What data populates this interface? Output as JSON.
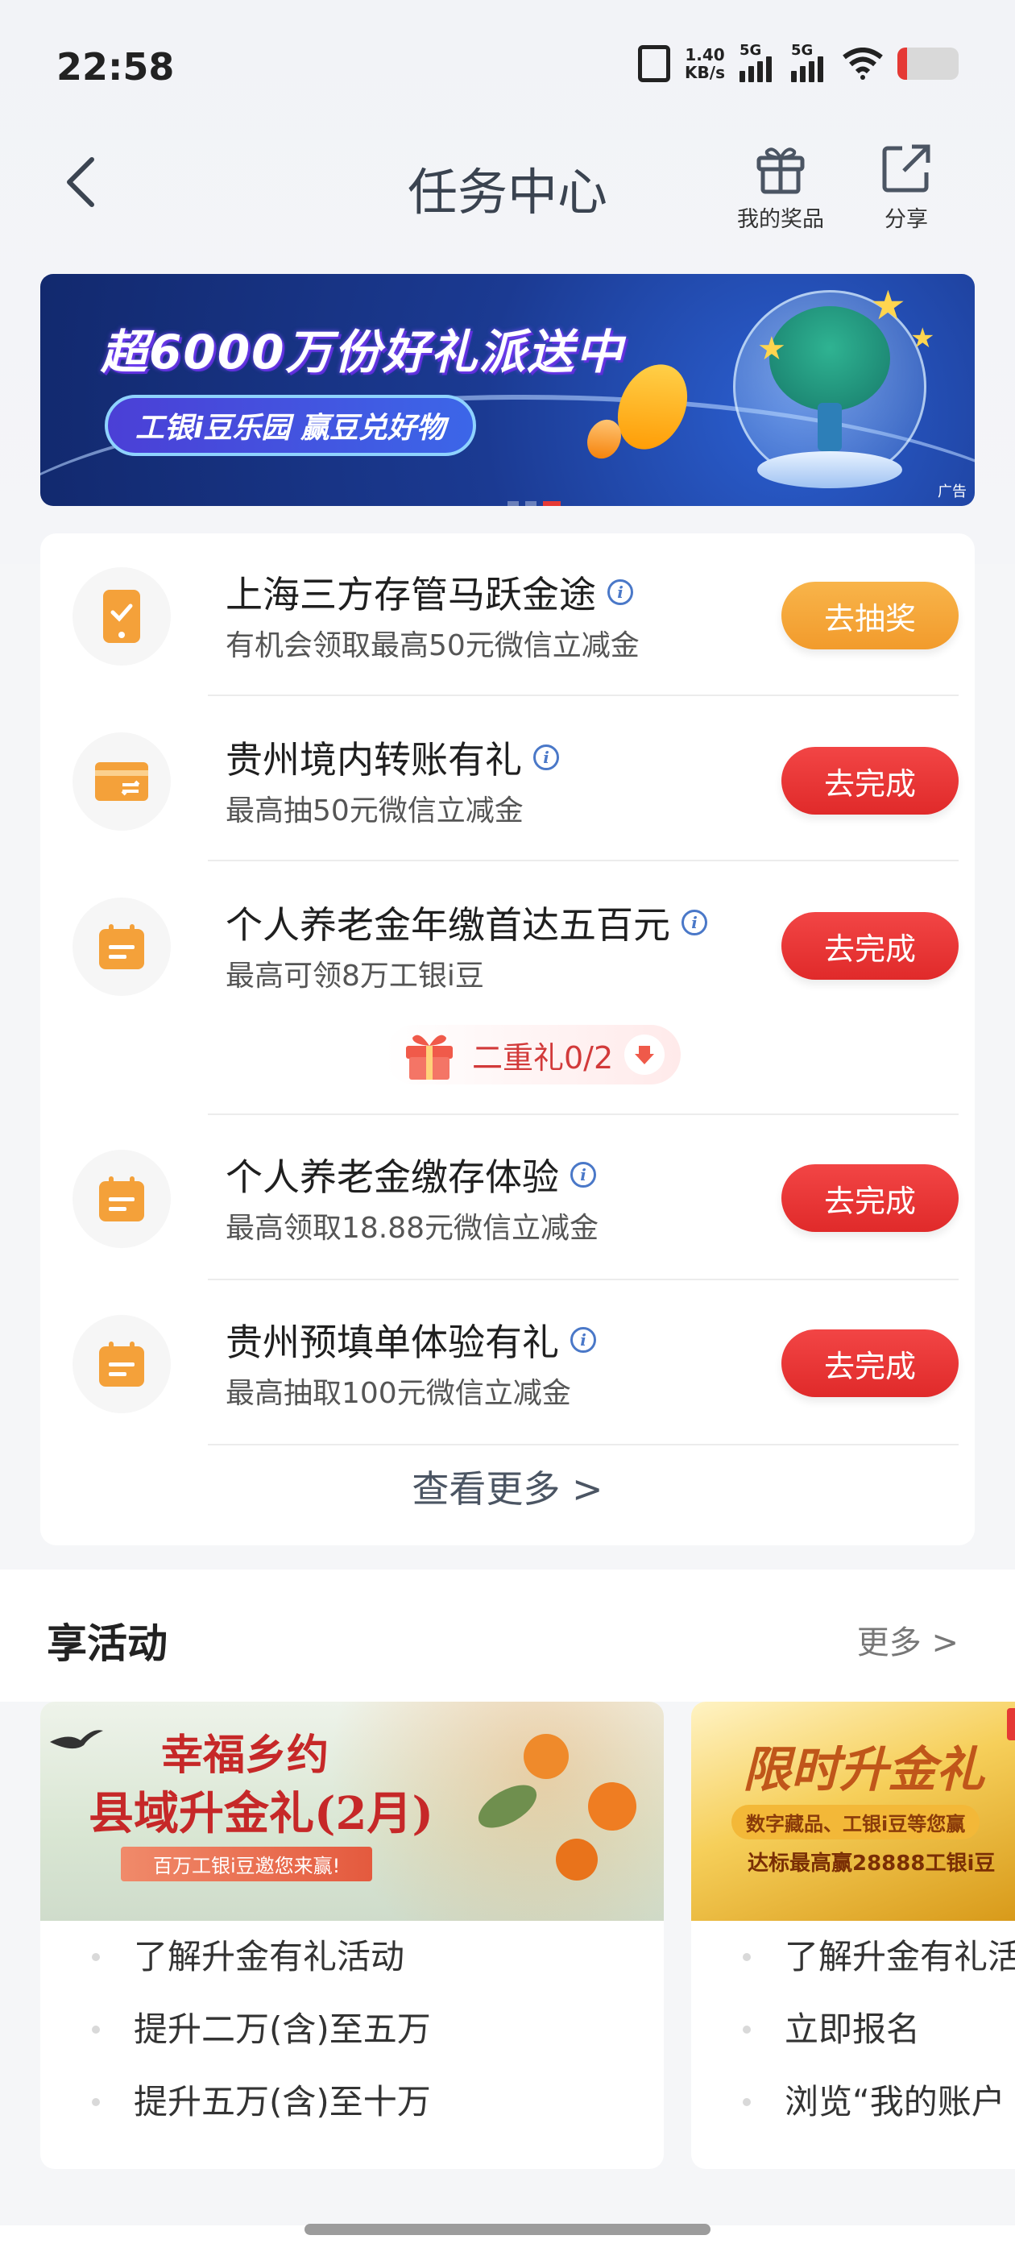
{
  "status_bar": {
    "time": "22:58",
    "net_speed_value": "1.40",
    "net_speed_unit": "KB/s",
    "signal1_label": "5G",
    "signal2_label": "5G"
  },
  "nav": {
    "title": "任务中心",
    "my_prizes_label": "我的奖品",
    "share_label": "分享"
  },
  "banner": {
    "headline": "超6000万份好礼派送中",
    "subline": "工银i豆乐园 赢豆兑好物",
    "ad_tag": "广告"
  },
  "tasks": [
    {
      "title": "上海三方存管马跃金途",
      "subtitle": "有机会领取最高50元微信立减金",
      "button": "去抽奖",
      "icon": "phone-icon"
    },
    {
      "title": "贵州境内转账有礼",
      "subtitle": "最高抽50元微信立减金",
      "button": "去完成",
      "icon": "card-transfer-icon"
    },
    {
      "title": "个人养老金年缴首达五百元",
      "subtitle": "最高可领8万工银i豆",
      "button": "去完成",
      "icon": "calendar-icon"
    },
    {
      "title": "个人养老金缴存体验",
      "subtitle": "最高领取18.88元微信立减金",
      "button": "去完成",
      "icon": "calendar-icon"
    },
    {
      "title": "贵州预填单体验有礼",
      "subtitle": "最高抽取100元微信立减金",
      "button": "去完成",
      "icon": "calendar-icon"
    }
  ],
  "gift_pill": {
    "label": "二重礼0/2"
  },
  "more_tasks": "查看更多 >",
  "activities": {
    "heading": "享活动",
    "more": "更多 >",
    "cards": [
      {
        "image_title_1": "幸福乡约",
        "image_title_2": "县域升金礼(2月)",
        "image_caption": "百万工银i豆邀您来赢!",
        "items": [
          "了解升金有礼活动",
          "提升二万(含)至五万",
          "提升五万(含)至十万"
        ]
      },
      {
        "image_title_1": "限时升金礼",
        "image_caption": "数字藏品、工银i豆等您赢",
        "image_caption_2": "达标最高赢28888工银i豆",
        "items": [
          "了解升金有礼活",
          "立即报名",
          "浏览“我的账户"
        ]
      }
    ]
  },
  "colors": {
    "orange_button": "#f29b2c",
    "red_button": "#e02a2a",
    "task_icon": "#f4a13a",
    "info_icon": "#4a78c8"
  }
}
